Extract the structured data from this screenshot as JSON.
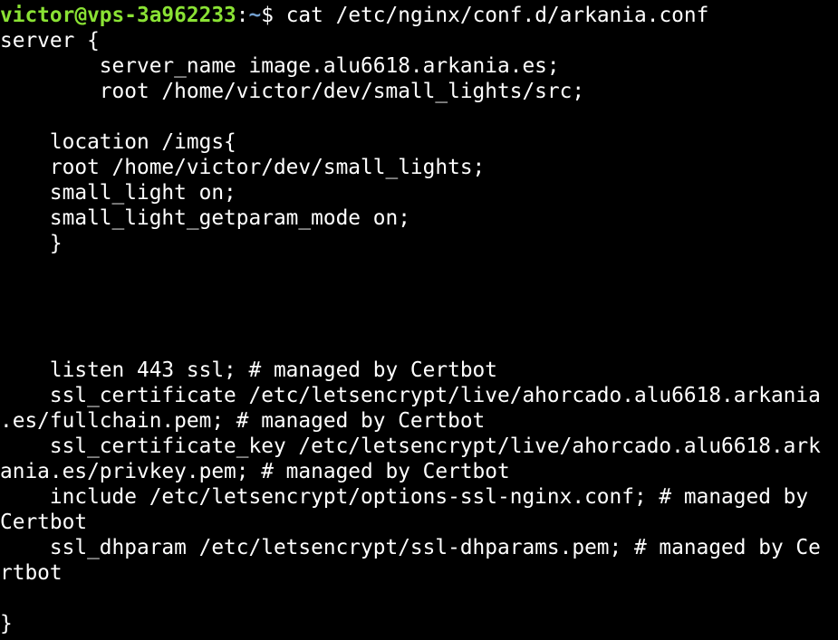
{
  "terminal": {
    "prompt_user_host": "victor@vps-3a962233",
    "prompt_colon": ":",
    "prompt_path": "~",
    "prompt_symbol": "$ ",
    "command": "cat /etc/nginx/conf.d/arkania.conf",
    "colors": {
      "background": "#000000",
      "text": "#ffffff",
      "user_host": "#8ae234",
      "path": "#729fcf"
    },
    "output_lines": [
      "server {",
      "        server_name image.alu6618.arkania.es;",
      "        root /home/victor/dev/small_lights/src;",
      "",
      "    location /imgs{",
      "    root /home/victor/dev/small_lights;",
      "    small_light on;",
      "    small_light_getparam_mode on;",
      "    }",
      "",
      "",
      "",
      "",
      "    listen 443 ssl; # managed by Certbot",
      "    ssl_certificate /etc/letsencrypt/live/ahorcado.alu6618.arkania",
      ".es/fullchain.pem; # managed by Certbot",
      "    ssl_certificate_key /etc/letsencrypt/live/ahorcado.alu6618.ark",
      "ania.es/privkey.pem; # managed by Certbot",
      "    include /etc/letsencrypt/options-ssl-nginx.conf; # managed by ",
      "Certbot",
      "    ssl_dhparam /etc/letsencrypt/ssl-dhparams.pem; # managed by Ce",
      "rtbot",
      "",
      "}"
    ]
  }
}
